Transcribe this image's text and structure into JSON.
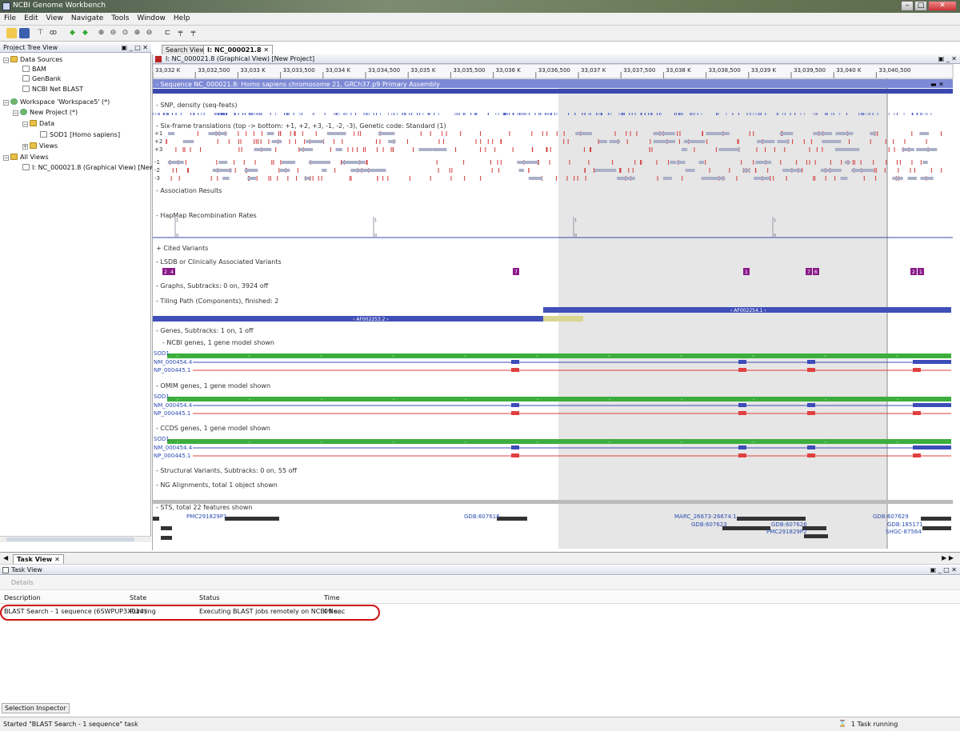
{
  "window": {
    "title": "NCBI Genome Workbench"
  },
  "menu": [
    "File",
    "Edit",
    "View",
    "Navigate",
    "Tools",
    "Window",
    "Help"
  ],
  "left_pane": {
    "title": "Project Tree View",
    "nodes": [
      {
        "label": "Data Sources",
        "icon": "folder"
      },
      {
        "label": "BAM",
        "icon": "doc"
      },
      {
        "label": "GenBank",
        "icon": "doc"
      },
      {
        "label": "NCBI Net BLAST",
        "icon": "doc"
      },
      {
        "label": "Workspace 'Workspace5' (*)",
        "icon": "ws"
      },
      {
        "label": "New Project (*)",
        "icon": "ws"
      },
      {
        "label": "Data",
        "icon": "folder"
      },
      {
        "label": "SOD1 [Homo sapiens]",
        "icon": "doc"
      },
      {
        "label": "Views",
        "icon": "folder"
      },
      {
        "label": "All Views",
        "icon": "folder"
      },
      {
        "label": "I: NC_000021.8 (Graphical View) [New Project]",
        "icon": "doc"
      }
    ]
  },
  "tabs": {
    "search": "Search View",
    "graphical": "I: NC_000021.8 ✕"
  },
  "graph_view": {
    "title": "I: NC_000021.8 (Graphical View) [New Project]",
    "ruler": [
      "33,032 K",
      "33,032,500",
      "33,033 K",
      "33,033,500",
      "33,034 K",
      "33,034,500",
      "33,035 K",
      "33,035,500",
      "33,036 K",
      "33,036,500",
      "33,037 K",
      "33,037,500",
      "33,038 K",
      "33,038,500",
      "33,039 K",
      "33,039,500",
      "33,040 K",
      "33,040,500"
    ],
    "sequence_title": "- Sequence NC_000021.8: Homo sapiens chromosome 21, GRCh37.p9 Primary Assembly",
    "tracks": {
      "snp": "- SNP, density (seq-feats)",
      "sixframe": "- Six-frame translations (top -> bottom: +1, +2, +3, -1, -2, -3), Genetic code: Standard (1)",
      "assoc": "- Association Results",
      "hapmap": "- HapMap Recombination Rates",
      "cited": "+ Cited Variants",
      "lsdb": "- LSDB or Clinically Associated Variants",
      "graphs": "- Graphs, Subtracks: 0 on, 3924 off",
      "tiling": "- Tiling Path (Components), finished: 2",
      "genes": "- Genes, Subtracks: 1 on, 1 off",
      "ncbi_genes": "- NCBI genes, 1 gene model shown",
      "omim_genes": "- OMIM genes, 1 gene model shown",
      "ccds_genes": "- CCDS genes, 1 gene model shown",
      "structural": "- Structural Variants, Subtracks: 0 on, 55 off",
      "ng": "- NG Alignments, total 1 object shown",
      "sts": "- STS, total 22 features shown"
    },
    "frames": [
      "+1",
      "+2",
      "+3",
      "-1",
      "-2",
      "-3"
    ],
    "components": [
      "‹ AF002253.2 ›",
      "‹ AF002254.1 ›"
    ],
    "lsdb_badges": [
      "2",
      "4",
      "7",
      "1",
      "7",
      "6",
      "2",
      "1"
    ],
    "gene_labels": {
      "gene": "SOD1",
      "mrna": "NM_000454.4",
      "protein": "NP_000445.1"
    },
    "sts_labels": [
      "PMC291829P1",
      "GDB:607616",
      "MARC_26673-26674:1...",
      "GDB:607629",
      "GDB:607623",
      "GDB:607626",
      "GDB:185171",
      "PMC291829P2",
      "SHGC-87564"
    ],
    "hapmap_ticks": [
      "1",
      "0",
      "1",
      "0",
      "1",
      "0",
      "1",
      "0"
    ]
  },
  "task_view": {
    "tab": "Task View ✕",
    "title": "Task View",
    "details_button": "Details",
    "columns": [
      "Description",
      "State",
      "Status",
      "Time"
    ],
    "rows": [
      {
        "description": "BLAST Search - 1 sequence (6SWPUP3X014)",
        "state": "Running",
        "status": "Executing BLAST jobs remotely on NCBI Ne...",
        "time": "09 sec"
      }
    ],
    "selection_inspector": "Selection Inspector"
  },
  "statusbar": {
    "message": "Started \"BLAST Search - 1 sequence\" task",
    "tasks": "1 Task running"
  },
  "colors": {
    "selection_shade": "#c8c8c8",
    "gene_green": "#3cae3c",
    "mrna_blue": "#3c4cb8",
    "protein_red": "#e04040",
    "lsdb_purple": "#8a1a8a",
    "highlight_red": "#cc1111"
  }
}
